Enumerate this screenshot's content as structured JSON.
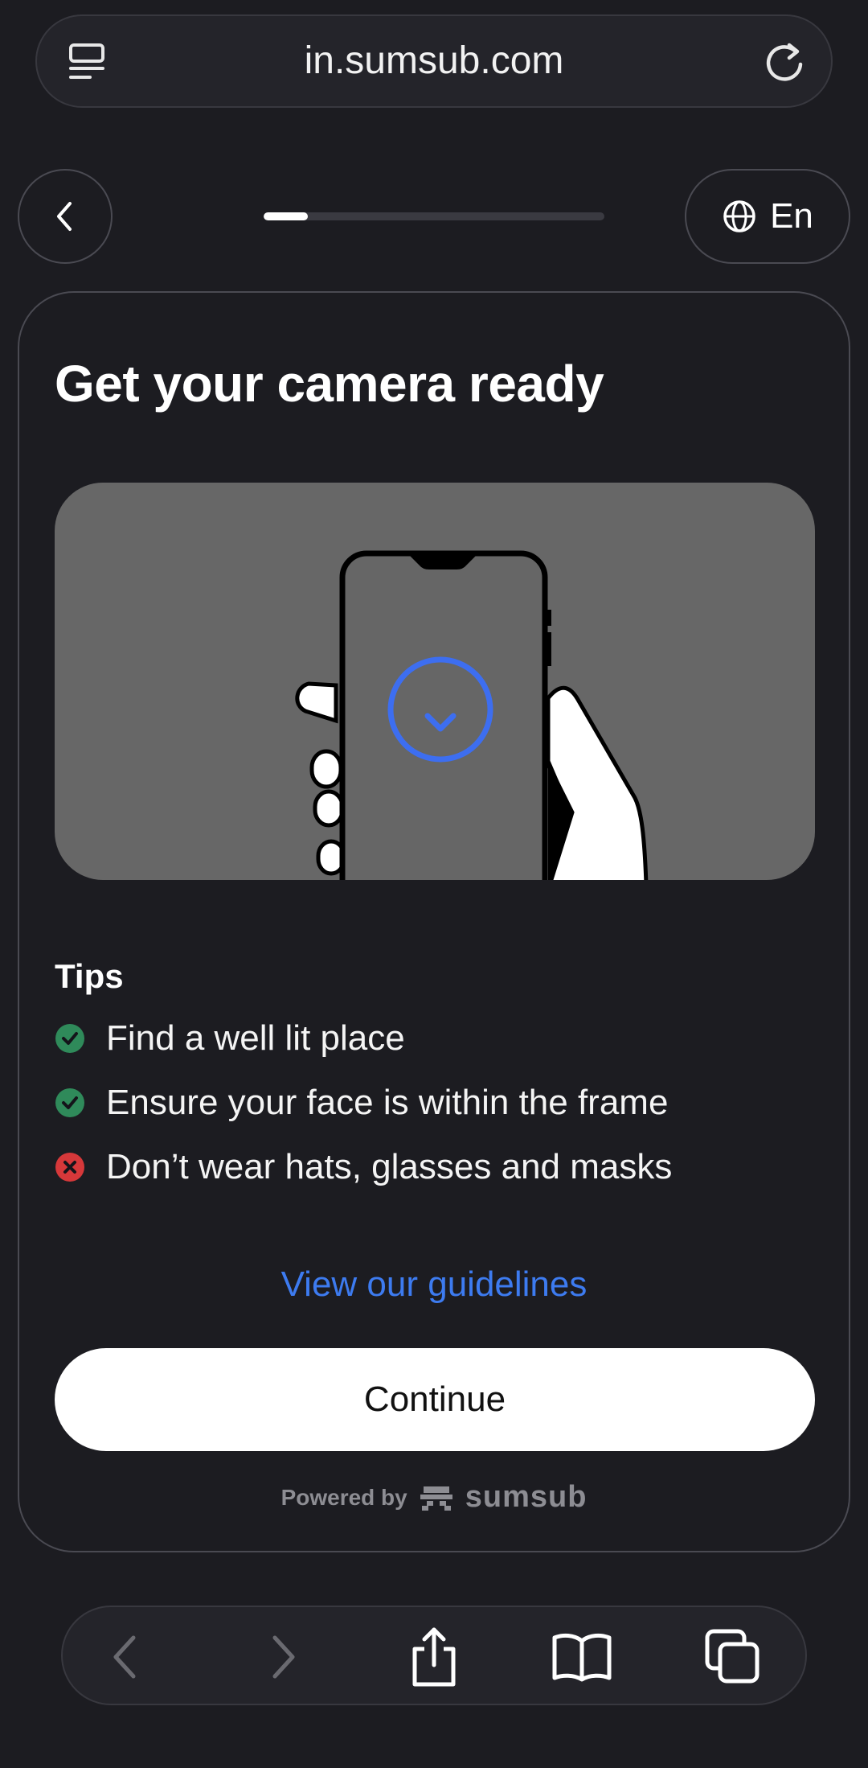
{
  "browser": {
    "url": "in.sumsub.com"
  },
  "nav": {
    "language": "En",
    "progress": 0.13
  },
  "card": {
    "title": "Get your camera ready",
    "tips_heading": "Tips",
    "tips": [
      {
        "text": "Find a well lit place",
        "status": "check"
      },
      {
        "text": "Ensure your face is within the frame",
        "status": "check"
      },
      {
        "text": "Don’t wear hats, glasses and masks",
        "status": "cross"
      }
    ],
    "guidelines_link": "View our guidelines",
    "continue_label": "Continue",
    "powered_by": "Powered by",
    "brand": "sumsub"
  },
  "colors": {
    "background": "#1c1c21",
    "accent_link": "#3d7bf0",
    "check_green": "#2f8a5a",
    "cross_red": "#d6383a",
    "illustration_bg": "#676767"
  },
  "icons": {
    "reader": "reader-mode-icon",
    "reload": "reload-icon",
    "back": "chevron-left-icon",
    "globe": "globe-icon",
    "toolbar": [
      "back-arrow-icon",
      "forward-arrow-icon",
      "share-icon",
      "bookmarks-icon",
      "tabs-icon"
    ]
  }
}
